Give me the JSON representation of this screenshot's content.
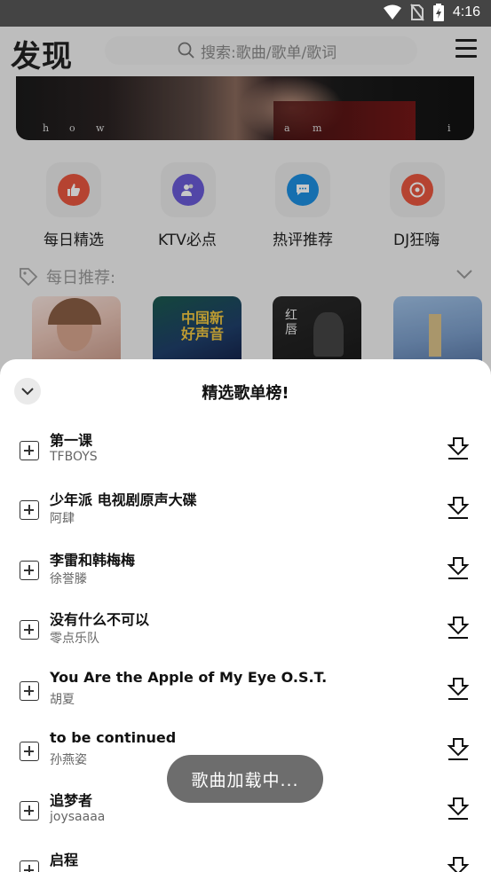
{
  "status": {
    "time": "4:16"
  },
  "header": {
    "title": "发现",
    "search_placeholder": "搜索:歌曲/歌单/歌词"
  },
  "banner": {
    "letters": [
      "h",
      "o",
      "w",
      "a",
      "m",
      "i"
    ]
  },
  "quick_links": [
    {
      "label": "每日精选",
      "icon": "thumbs-up-icon",
      "color": "#e8573f"
    },
    {
      "label": "KTV必点",
      "icon": "users-icon",
      "color": "#6a5ad6"
    },
    {
      "label": "热评推荐",
      "icon": "comment-icon",
      "color": "#1d8fe0"
    },
    {
      "label": "DJ狂嗨",
      "icon": "disc-icon",
      "color": "#e8573f"
    }
  ],
  "daily": {
    "title": "每日推荐:"
  },
  "covers": [
    {
      "text": ""
    },
    {
      "text": "中国新好声音"
    },
    {
      "text": "红唇"
    },
    {
      "text": ""
    }
  ],
  "sheet": {
    "title": "精选歌单榜!",
    "songs": [
      {
        "title": "第一课",
        "artist": "TFBOYS"
      },
      {
        "title": "少年派 电视剧原声大碟",
        "artist": "阿肆"
      },
      {
        "title": "李雷和韩梅梅",
        "artist": "徐誉滕"
      },
      {
        "title": "没有什么不可以",
        "artist": "零点乐队"
      },
      {
        "title": "You Are the Apple of My Eye O.S.T.",
        "artist": "胡夏"
      },
      {
        "title": "to be continued",
        "artist": "孙燕姿"
      },
      {
        "title": "追梦者",
        "artist": "joysaaaa"
      },
      {
        "title": "启程",
        "artist": ""
      }
    ]
  },
  "toast": {
    "text": "歌曲加载中..."
  }
}
